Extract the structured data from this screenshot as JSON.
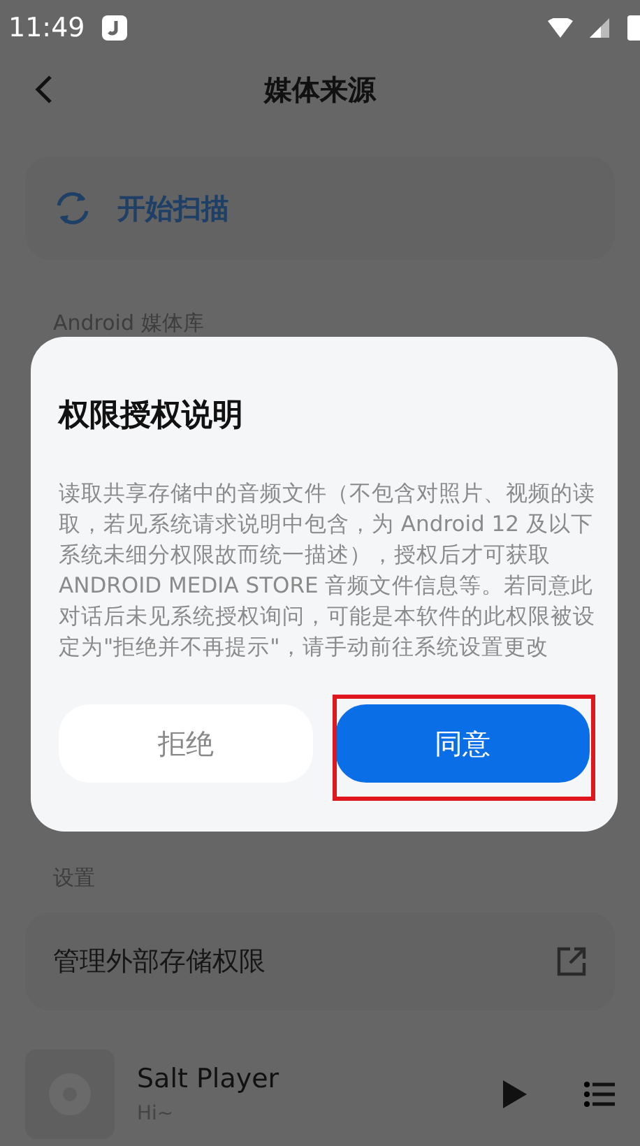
{
  "status_bar": {
    "time": "11:49"
  },
  "header": {
    "title": "媒体来源"
  },
  "scan_card": {
    "label": "开始扫描"
  },
  "sections": [
    {
      "title": "Android 媒体库"
    },
    {
      "title": "设置"
    }
  ],
  "settings_item": {
    "label": "管理外部存储权限"
  },
  "dialog": {
    "title": "权限授权说明",
    "body": "读取共享存储中的音频文件（不包含对照片、视频的读取，若见系统请求说明中包含，为 Android 12 及以下系统未细分权限故而统一描述），授权后才可获取 ANDROID MEDIA STORE 音频文件信息等。若同意此对话后未见系统授权询问，可能是本软件的此权限被设定为\"拒绝并不再提示\"，请手动前往系统设置更改",
    "buttons": [
      {
        "label": "拒绝",
        "kind": "secondary"
      },
      {
        "label": "同意",
        "kind": "primary"
      }
    ]
  },
  "player": {
    "title": "Salt Player",
    "subtitle": "Hi~"
  }
}
